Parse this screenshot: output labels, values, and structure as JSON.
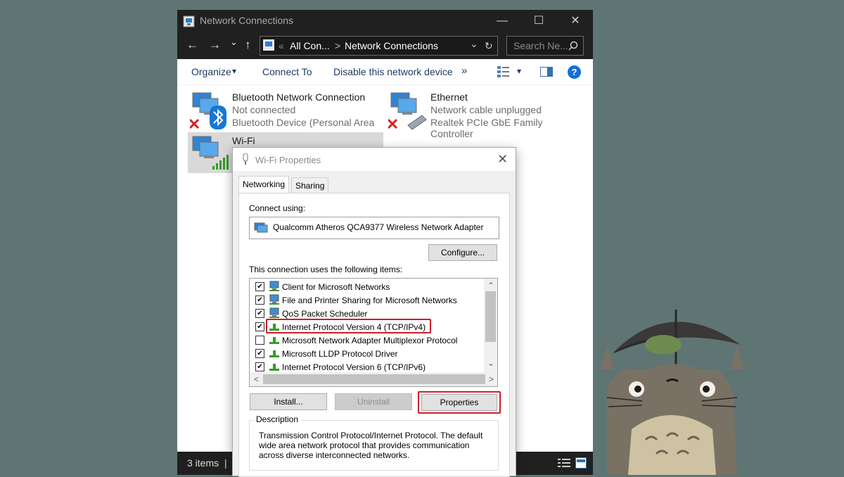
{
  "window": {
    "title": "Network Connections",
    "minimize_glyph": "—",
    "maximize_glyph": "☐",
    "close_glyph": "✕"
  },
  "nav": {
    "back_glyph": "←",
    "forward_glyph": "→",
    "recent_glyph": "⌄",
    "up_glyph": "↑"
  },
  "address": {
    "overflow_glyph": "«",
    "crumb1": "All Con...",
    "separator": ">",
    "crumb2": "Network Connections",
    "dropdown_glyph": "⌄",
    "refresh_glyph": "↻"
  },
  "search": {
    "placeholder": "Search Ne..."
  },
  "commands": {
    "organize": "Organize",
    "dropdown_glyph": "▾",
    "connect_to": "Connect To",
    "disable_device": "Disable this network device",
    "more": "»",
    "help": "?"
  },
  "connections": [
    {
      "name": "Bluetooth Network Connection",
      "status": "Not connected",
      "device": "Bluetooth Device (Personal Area ..."
    },
    {
      "name": "Ethernet",
      "status": "Network cable unplugged",
      "device": "Realtek PCIe GbE Family Controller"
    },
    {
      "name": "Wi-Fi"
    }
  ],
  "statusbar": {
    "count": "3 items",
    "divider": "|"
  },
  "dialog": {
    "title": "Wi-Fi Properties",
    "close_glyph": "✕",
    "tabs": [
      "Networking",
      "Sharing"
    ],
    "connect_using_label": "Connect using:",
    "adapter": "Qualcomm Atheros QCA9377 Wireless Network Adapter",
    "configure_button": "Configure...",
    "items_label": "This connection uses the following items:",
    "items": [
      {
        "label": "Client for Microsoft Networks",
        "checked": true
      },
      {
        "label": "File and Printer Sharing for Microsoft Networks",
        "checked": true
      },
      {
        "label": "QoS Packet Scheduler",
        "checked": true
      },
      {
        "label": "Internet Protocol Version 4 (TCP/IPv4)",
        "checked": true
      },
      {
        "label": "Microsoft Network Adapter Multiplexor Protocol",
        "checked": false
      },
      {
        "label": "Microsoft LLDP Protocol Driver",
        "checked": true
      },
      {
        "label": "Internet Protocol Version 6 (TCP/IPv6)",
        "checked": true
      }
    ],
    "scroll_up": "⌃",
    "scroll_down": "⌄",
    "scroll_left": "<",
    "scroll_right": ">",
    "install_button": "Install...",
    "uninstall_button": "Uninstall",
    "properties_button": "Properties",
    "description_label": "Description",
    "description": "Transmission Control Protocol/Internet Protocol. The default wide area network protocol that provides communication across diverse interconnected networks."
  },
  "colors": {
    "desktop": "#5e7573",
    "titlebar": "#202020",
    "highlight": "#cc1f2a",
    "selection": "#d9d9d9",
    "link": "#1c3b63"
  }
}
